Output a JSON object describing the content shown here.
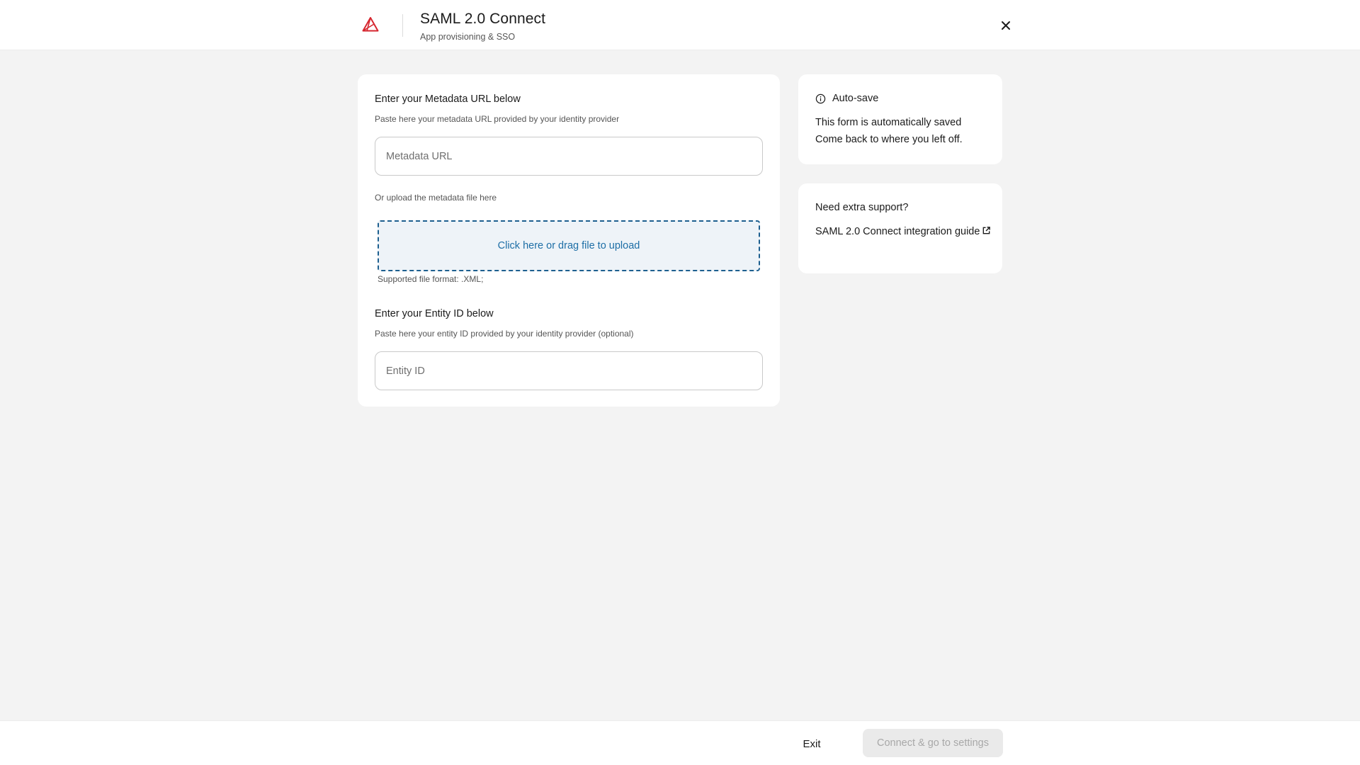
{
  "header": {
    "title": "SAML 2.0 Connect",
    "subtitle": "App provisioning & SSO",
    "logo_icon": "triangle-logo-icon",
    "close_icon": "close-icon"
  },
  "metadata": {
    "title": "Enter your Metadata URL below",
    "description": "Paste here your metadata URL provided by your identity provider",
    "url_placeholder": "Metadata URL",
    "url_value": "",
    "upload_label": "Or upload the metadata file here",
    "upload_button": "Click here or drag file to upload",
    "upload_hint": "Supported file format: .XML;"
  },
  "entity": {
    "title": "Enter your Entity ID below",
    "description": "Paste here your entity ID provided by your identity provider (optional)",
    "placeholder": "Entity ID",
    "value": ""
  },
  "autosave": {
    "title": "Auto-save",
    "line1": "This form is automatically saved",
    "line2": "Come back to where you left off.",
    "icon": "info-icon"
  },
  "support": {
    "title": "Need extra support?",
    "link_text": "SAML 2.0 Connect integration guide",
    "icon": "external-link-icon"
  },
  "footer": {
    "exit_label": "Exit",
    "primary_label": "Connect & go to settings",
    "primary_disabled": true
  },
  "colors": {
    "accent": "#1d6ea6",
    "upload_border": "#1d5f8f",
    "upload_bg": "#eef3f8",
    "logo": "#d6262f",
    "page_bg": "#f3f3f3"
  }
}
